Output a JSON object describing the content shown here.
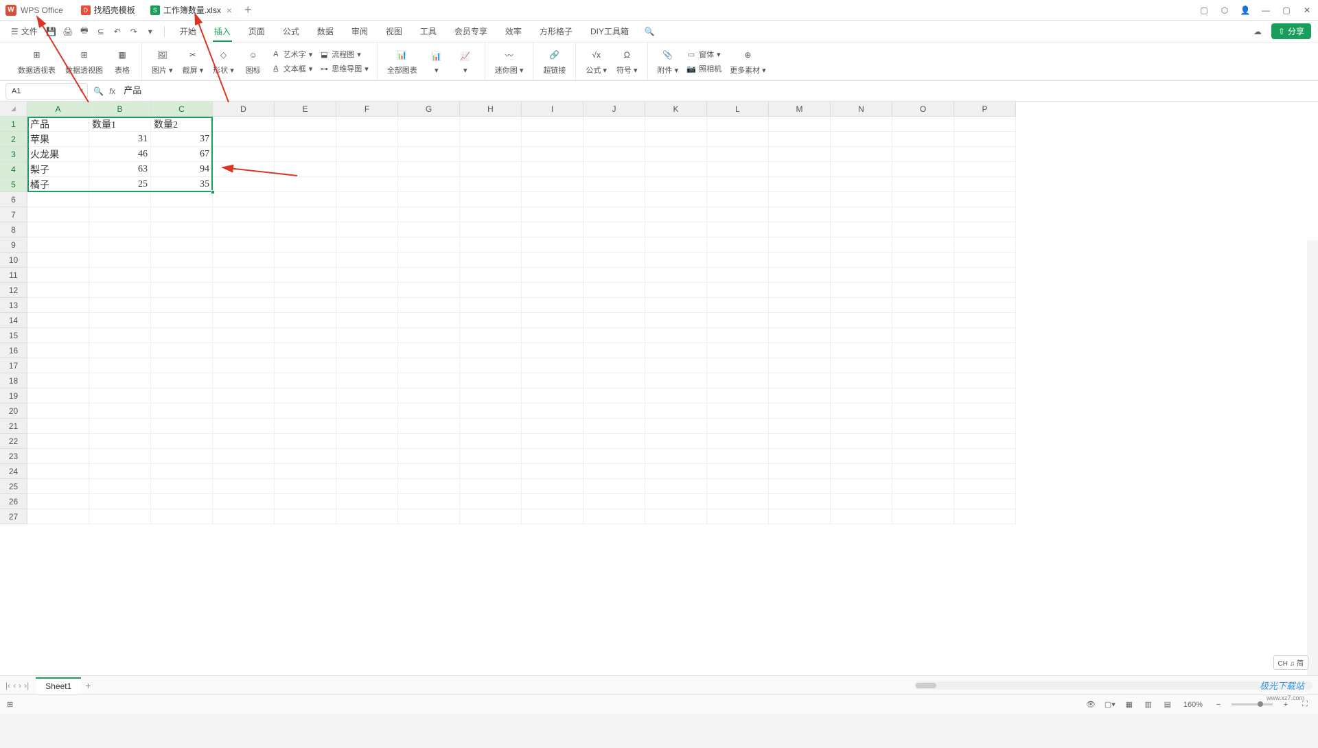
{
  "app": {
    "name": "WPS Office"
  },
  "tabs": [
    {
      "icon": "red",
      "label": "找稻壳模板"
    },
    {
      "icon": "green",
      "label": "工作簿数量.xlsx",
      "active": true
    }
  ],
  "file_menu": "文件",
  "menu": {
    "items": [
      "开始",
      "插入",
      "页面",
      "公式",
      "数据",
      "审阅",
      "视图",
      "工具",
      "会员专享",
      "效率",
      "方形格子",
      "DIY工具箱"
    ],
    "active": "插入"
  },
  "share": "分享",
  "ribbon": {
    "pivot_table": "数据透视表",
    "pivot_chart": "数据透视图",
    "table": "表格",
    "picture": "图片",
    "screenshot": "截屏",
    "shapes": "形状",
    "icons": "图标",
    "wordart": "艺术字",
    "textbox": "文本框",
    "flowchart": "流程图",
    "mindmap": "思维导图",
    "all_charts": "全部图表",
    "sparkline": "迷你图",
    "hyperlink": "超链接",
    "formula": "公式",
    "symbol": "符号",
    "attachment": "附件",
    "camera": "照相机",
    "object": "窗体",
    "more": "更多素材"
  },
  "namebox": "A1",
  "formula_value": "产品",
  "columns": [
    "A",
    "B",
    "C",
    "D",
    "E",
    "F",
    "G",
    "H",
    "I",
    "J",
    "K",
    "L",
    "M",
    "N",
    "O",
    "P"
  ],
  "rows_visible": 27,
  "selected_cols": 3,
  "selected_rows": 5,
  "data": [
    [
      "产品",
      "数量1",
      "数量2"
    ],
    [
      "苹果",
      "31",
      "37"
    ],
    [
      "火龙果",
      "46",
      "67"
    ],
    [
      "梨子",
      "63",
      "94"
    ],
    [
      "橘子",
      "25",
      "35"
    ]
  ],
  "sheet_tab": "Sheet1",
  "zoom": "160%",
  "ime": "CH ♫ 简",
  "watermark": "极光下载站",
  "watermark_url": "www.xz7.com",
  "chart_data": {
    "type": "table",
    "title": "",
    "columns": [
      "产品",
      "数量1",
      "数量2"
    ],
    "rows": [
      {
        "产品": "苹果",
        "数量1": 31,
        "数量2": 37
      },
      {
        "产品": "火龙果",
        "数量1": 46,
        "数量2": 67
      },
      {
        "产品": "梨子",
        "数量1": 63,
        "数量2": 94
      },
      {
        "产品": "橘子",
        "数量1": 25,
        "数量2": 35
      }
    ]
  }
}
